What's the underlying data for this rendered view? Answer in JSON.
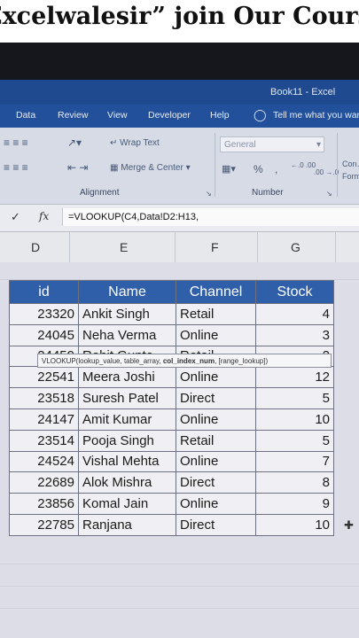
{
  "banner": {
    "text": "Excelwalesir” join Our Course"
  },
  "window": {
    "title": "Book11 - Excel"
  },
  "ribbon_tabs": [
    "Data",
    "Review",
    "View",
    "Developer",
    "Help",
    "Tell me what you want"
  ],
  "ribbon": {
    "wrap_text": "Wrap Text",
    "merge_center": "Merge & Center",
    "number_format": "General",
    "percent": "%",
    "comma": ",",
    "inc_decimal": "←.0 .00",
    "dec_decimal": ".00 →.0",
    "conditional": "Con…",
    "format_as": "Form…",
    "alignment_label": "Alignment",
    "number_label": "Number"
  },
  "formula_bar": {
    "check": "✓",
    "fx": "fx",
    "formula": "=VLOOKUP(C4,Data!D2:H13,"
  },
  "tooltip": {
    "fn": "VLOOKUP(",
    "a1": "lookup_value, table_array, ",
    "a2": "col_index_num",
    "a3": ", [range_lookup])"
  },
  "columns": [
    "D",
    "E",
    "F",
    "G"
  ],
  "table": {
    "headers": [
      "id",
      "Name",
      "Channel",
      "Stock"
    ],
    "rows": [
      [
        "23320",
        "Ankit Singh",
        "Retail",
        "4"
      ],
      [
        "24045",
        "Neha Verma",
        "Online",
        "3"
      ],
      [
        "24459",
        "Rohit Gupta",
        "Retail",
        "2"
      ],
      [
        "22541",
        "Meera Joshi",
        "Online",
        "12"
      ],
      [
        "23518",
        "Suresh Patel",
        "Direct",
        "5"
      ],
      [
        "24147",
        "Amit Kumar",
        "Online",
        "10"
      ],
      [
        "23514",
        "Pooja Singh",
        "Retail",
        "5"
      ],
      [
        "24524",
        "Vishal Mehta",
        "Online",
        "7"
      ],
      [
        "22689",
        "Alok Mishra",
        "Direct",
        "8"
      ],
      [
        "23856",
        "Komal Jain",
        "Online",
        "9"
      ],
      [
        "22785",
        "Ranjana",
        "Direct",
        "10"
      ]
    ]
  },
  "colors": {
    "ribbon_blue": "#22509a",
    "header_fill": "#2f5fa8"
  }
}
